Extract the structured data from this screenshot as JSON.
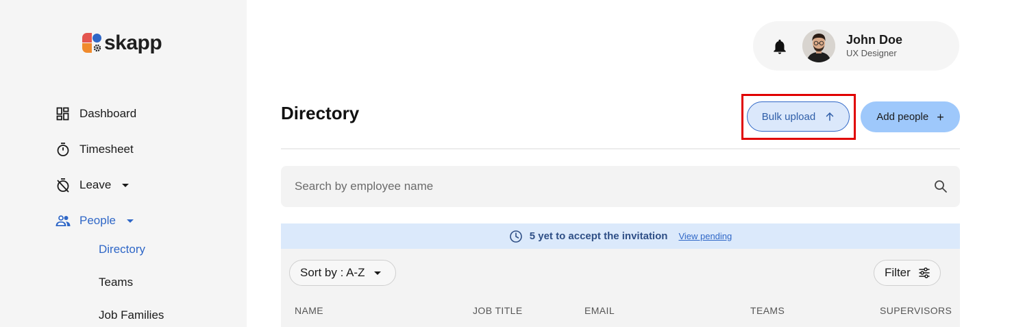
{
  "brand": {
    "name": "skapp"
  },
  "sidebar": {
    "items": [
      {
        "label": "Dashboard",
        "icon": "dashboard-icon"
      },
      {
        "label": "Timesheet",
        "icon": "stopwatch-icon"
      },
      {
        "label": "Leave",
        "icon": "leave-timer-icon"
      },
      {
        "label": "People",
        "icon": "people-icon"
      }
    ],
    "people_sub": [
      {
        "label": "Directory"
      },
      {
        "label": "Teams"
      },
      {
        "label": "Job Families"
      }
    ]
  },
  "header": {
    "user_name": "John Doe",
    "user_role": "UX Designer"
  },
  "main": {
    "title": "Directory",
    "bulk_upload_label": "Bulk upload",
    "add_people_label": "Add people",
    "search_placeholder": "Search by employee name",
    "banner_message": "5 yet to accept the invitation",
    "banner_link": "View pending",
    "sort_label": "Sort by : A-Z",
    "filter_label": "Filter",
    "columns": [
      "NAME",
      "JOB TITLE",
      "EMAIL",
      "TEAMS",
      "SUPERVISORS"
    ]
  },
  "colors": {
    "accent": "#2f67c7",
    "highlight": "#e00000",
    "banner_bg": "#dbe9fb",
    "primary_button": "#9ec8fb"
  }
}
